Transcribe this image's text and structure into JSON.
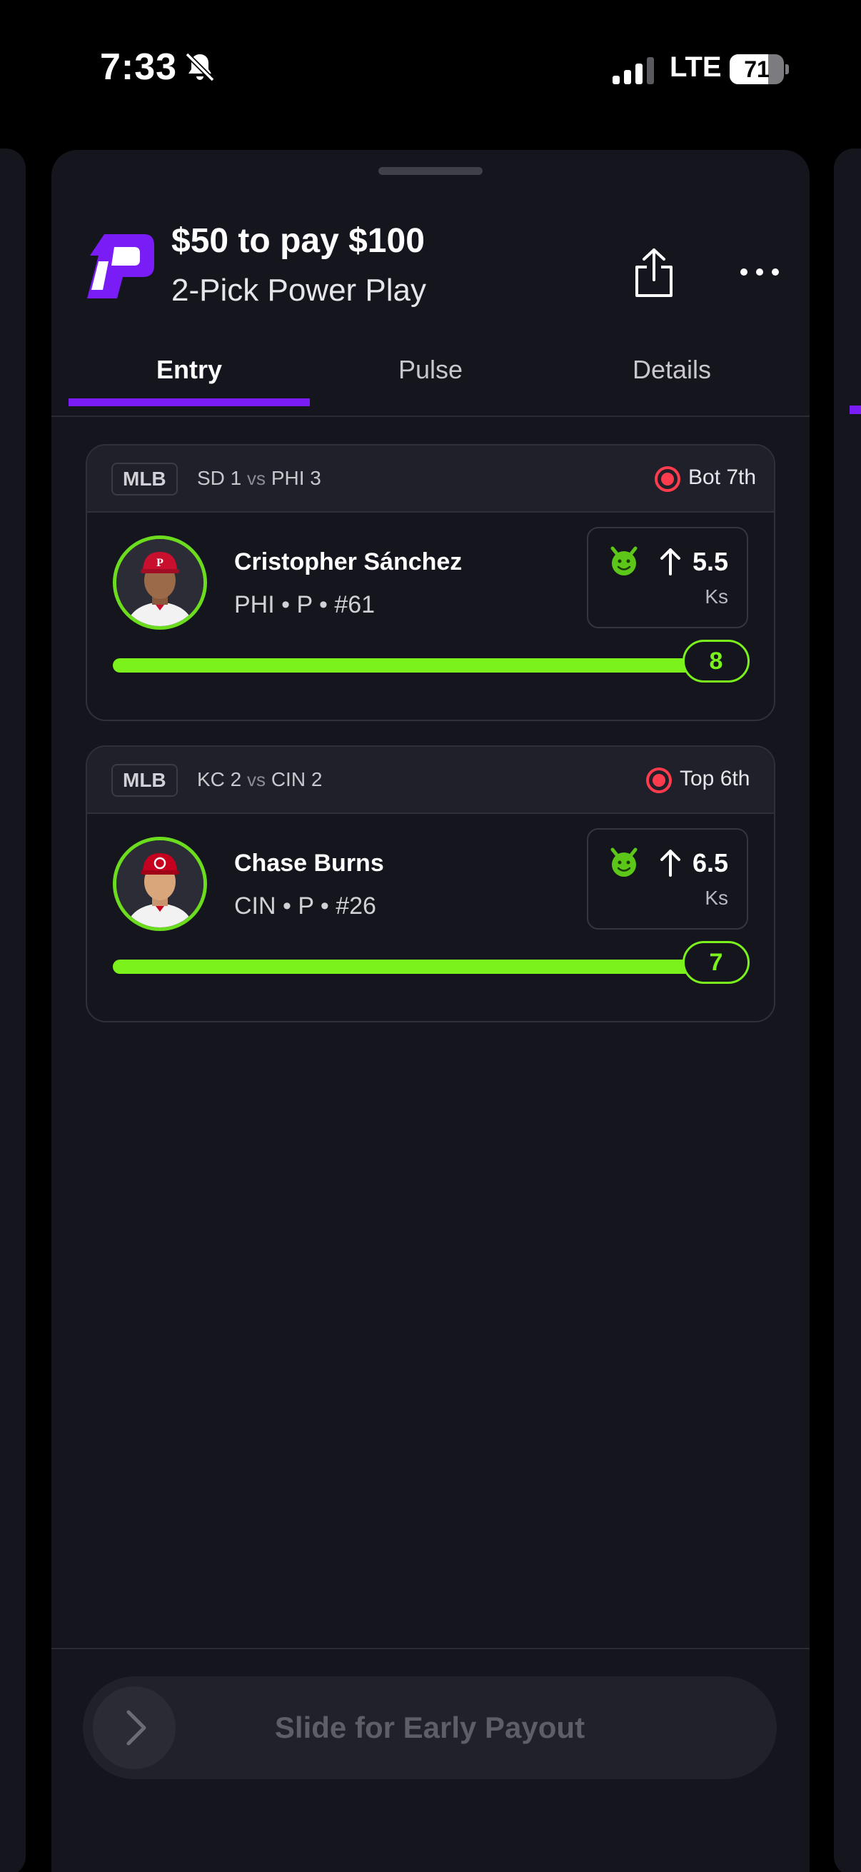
{
  "status_bar": {
    "time": "7:33",
    "network": "LTE",
    "battery": "71",
    "battery_level": 0.71
  },
  "entry": {
    "title": "$50 to pay $100",
    "subtitle": "2-Pick Power Play",
    "icons": [
      "logo-icon",
      "share-icon",
      "more-icon"
    ]
  },
  "tabs": [
    {
      "label": "Entry",
      "active": true
    },
    {
      "label": "Pulse",
      "active": false
    },
    {
      "label": "Details",
      "active": false
    }
  ],
  "picks": [
    {
      "league": "MLB",
      "away": "SD 1",
      "vs": "vs",
      "home": "PHI 3",
      "inning": "Bot 7th",
      "player_name": "Cristopher Sánchez",
      "player_meta": "PHI • P • #61",
      "line": "5.5",
      "stat": "Ks",
      "direction": "over",
      "current": "8",
      "progress": 1.0,
      "cap_color": "#c8102e"
    },
    {
      "league": "MLB",
      "away": "KC 2",
      "vs": "vs",
      "home": "CIN 2",
      "inning": "Top 6th",
      "player_name": "Chase Burns",
      "player_meta": "CIN • P • #26",
      "line": "6.5",
      "stat": "Ks",
      "direction": "over",
      "current": "7",
      "progress": 1.0,
      "cap_color": "#c6011f"
    }
  ],
  "footer": {
    "slider_label": "Slide for Early Payout"
  },
  "colors": {
    "accent": "#7a1cf5",
    "success": "#7bf21c",
    "live": "#ff3b4e"
  }
}
